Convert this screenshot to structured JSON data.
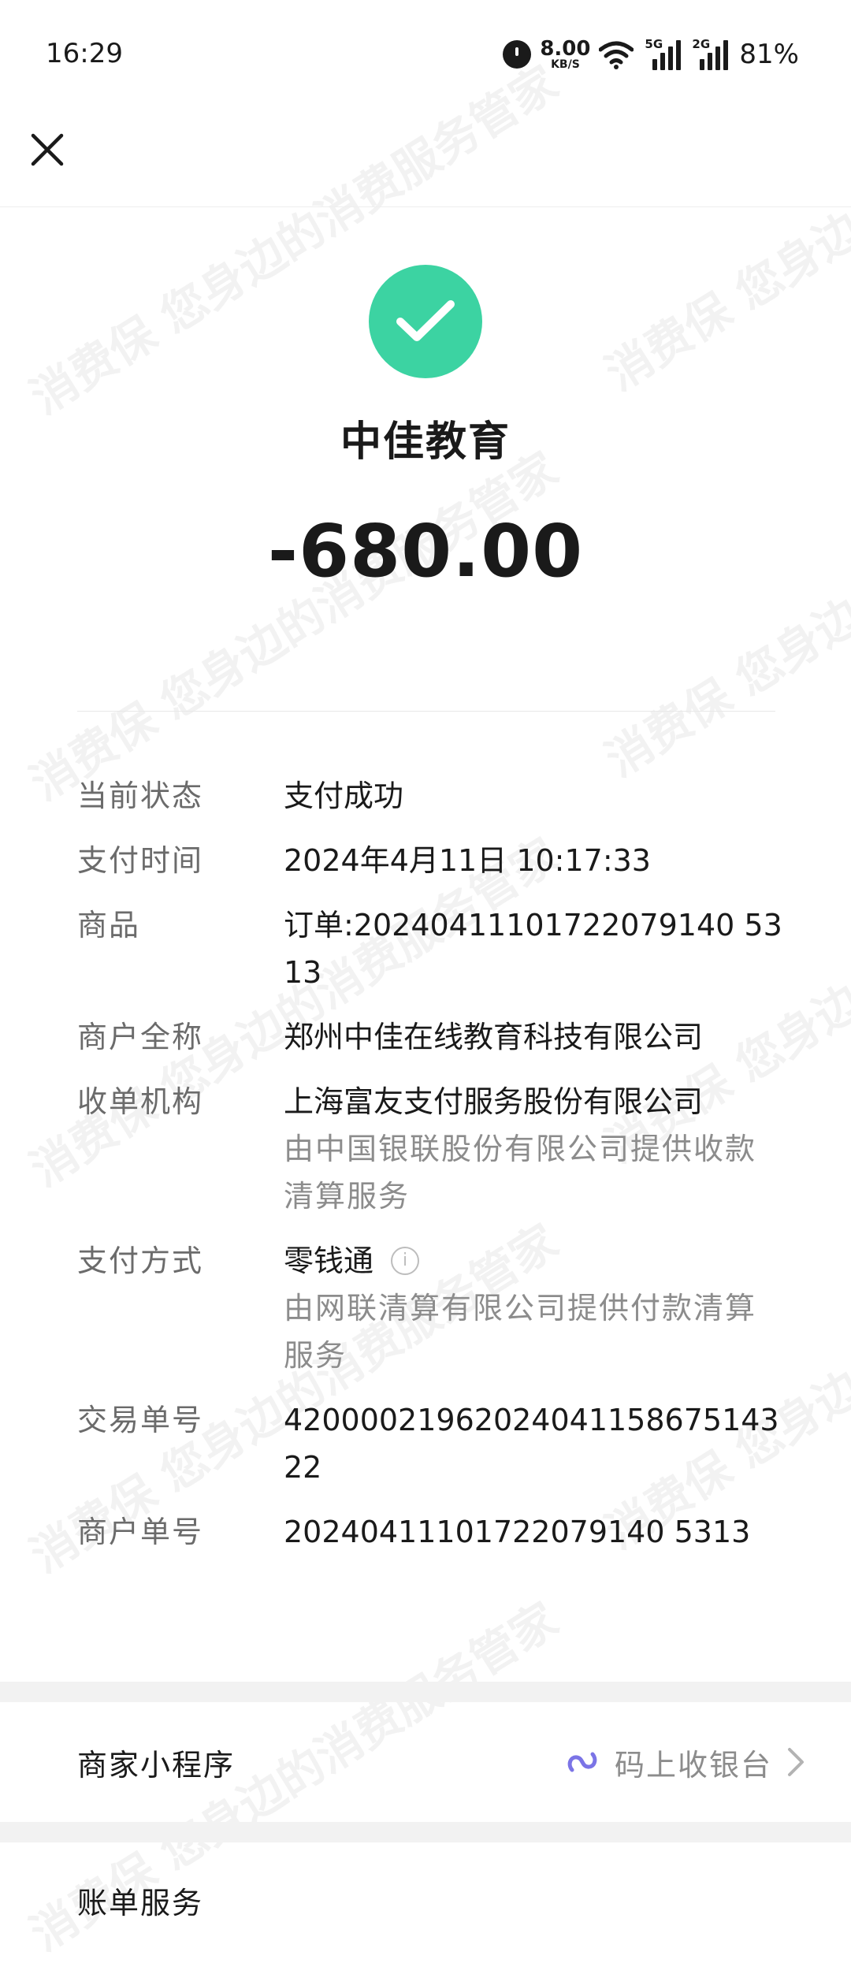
{
  "status_bar": {
    "time": "16:29",
    "net_speed_value": "8.00",
    "net_speed_unit": "KB/S",
    "signal1_label": "5G",
    "signal2_label": "2G",
    "battery": "81%"
  },
  "header": {
    "close_icon": "close-icon"
  },
  "hero": {
    "status_color": "#3cd3a2",
    "merchant": "中佳教育",
    "amount": "-680.00"
  },
  "details": {
    "status_label": "当前状态",
    "status_value": "支付成功",
    "time_label": "支付时间",
    "time_value": "2024年4月11日 10:17:33",
    "goods_label": "商品",
    "goods_value": "订单:20240411101722079140 5313",
    "merchant_full_label": "商户全称",
    "merchant_full_value": "郑州中佳在线教育科技有限公司",
    "acquirer_label": "收单机构",
    "acquirer_value": "上海富友支付服务股份有限公司",
    "acquirer_note": "由中国银联股份有限公司提供收款清算服务",
    "method_label": "支付方式",
    "method_value": "零钱通",
    "method_note": "由网联清算有限公司提供付款清算服务",
    "txn_label": "交易单号",
    "txn_value": "4200002196202404115867514322",
    "merchant_order_label": "商户单号",
    "merchant_order_value": "20240411101722079140 5313"
  },
  "mini_program": {
    "title": "商家小程序",
    "link_label": "码上收银台",
    "link_icon": "mini-program-link-icon"
  },
  "billing": {
    "title": "账单服务"
  },
  "watermark": "消费保 您身边的消费服务管家"
}
